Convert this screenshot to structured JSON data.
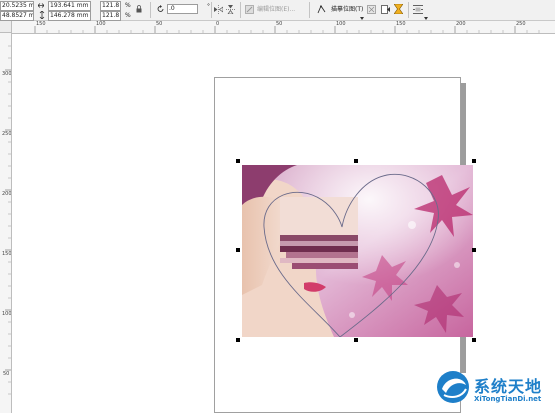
{
  "property_bar": {
    "x_position": "20.5235 mm",
    "y_position": "48.8527 mm",
    "width": "193.641 mm",
    "height": "146.278 mm",
    "scale_x": "121.8",
    "scale_y": "121.8",
    "percent_x": "%",
    "percent_y": "%",
    "rotation": ".0",
    "degree_symbol": "°",
    "edit_bitmap_label": "编辑位图(E)...",
    "trace_bitmap_label": "描摹位图(T)"
  },
  "rulers": {
    "horizontal_ticks": [
      "150",
      "100",
      "50",
      "0",
      "50",
      "100",
      "150",
      "200",
      "250"
    ],
    "vertical_ticks": [
      "300",
      "250",
      "200",
      "150",
      "100",
      "50"
    ]
  },
  "watermark": {
    "brand": "系统天地",
    "url": "XiTongTianDi.net"
  },
  "colors": {
    "brand_blue": "#1e7fc9",
    "toolbar_bg": "#f1f1f1",
    "ruler_bg": "#f5f5f5"
  }
}
